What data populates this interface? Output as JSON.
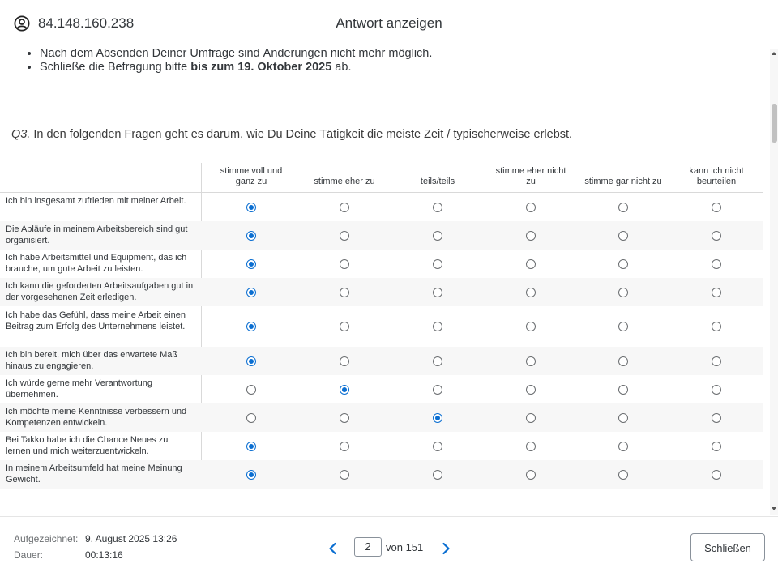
{
  "header": {
    "ip": "84.148.160.238",
    "title": "Antwort anzeigen"
  },
  "notes": {
    "item1": "Nach dem Absenden Deiner Umfrage sind Änderungen nicht mehr möglich.",
    "item2_prefix": "Schließe die Befragung bitte ",
    "item2_bold": "bis zum 19. Oktober 2025",
    "item2_suffix": " ab."
  },
  "question": {
    "number": "Q3.",
    "text": " In den folgenden Fragen geht es darum, wie Du Deine Tätigkeit die meiste Zeit / typischerweise erlebst."
  },
  "columns": [
    "stimme voll und ganz zu",
    "stimme eher zu",
    "teils/teils",
    "stimme eher nicht zu",
    "stimme gar nicht zu",
    "kann ich nicht beurteilen"
  ],
  "rows": [
    {
      "label": "Ich bin insgesamt zufrieden mit meiner Arbeit.",
      "selected": 0
    },
    {
      "label": "Die Abläufe in meinem Arbeitsbereich sind gut organisiert.",
      "selected": 0
    },
    {
      "label": "Ich habe Arbeitsmittel und Equipment, das ich brauche, um gute Arbeit zu leisten.",
      "selected": 0
    },
    {
      "label": "Ich kann die geforderten Arbeitsaufgaben gut in der vorgesehenen Zeit erledigen.",
      "selected": 0
    },
    {
      "label": "Ich habe das Gefühl, dass meine Arbeit einen Beitrag zum Erfolg des Unternehmens leistet.",
      "selected": 0
    },
    {
      "label": "Ich bin bereit, mich über das erwartete Maß hinaus zu engagieren.",
      "selected": 0
    },
    {
      "label": "Ich würde gerne mehr Verantwortung übernehmen.",
      "selected": 1
    },
    {
      "label": "Ich möchte meine Kenntnisse verbessern und Kompetenzen entwickeln.",
      "selected": 2
    },
    {
      "label": "Bei Takko habe ich die Chance Neues zu lernen und mich weiterzuentwickeln.",
      "selected": 0
    },
    {
      "label": "In meinem Arbeitsumfeld hat meine Meinung Gewicht.",
      "selected": 0
    }
  ],
  "footer": {
    "recorded_label": "Aufgezeichnet:",
    "recorded_value": "9. August 2025 13:26",
    "duration_label": "Dauer:",
    "duration_value": "00:13:16",
    "page_current": "2",
    "page_total": "von 151",
    "close_label": "Schließen"
  },
  "colors": {
    "accent": "#0a6ed1",
    "text": "#32363a"
  }
}
